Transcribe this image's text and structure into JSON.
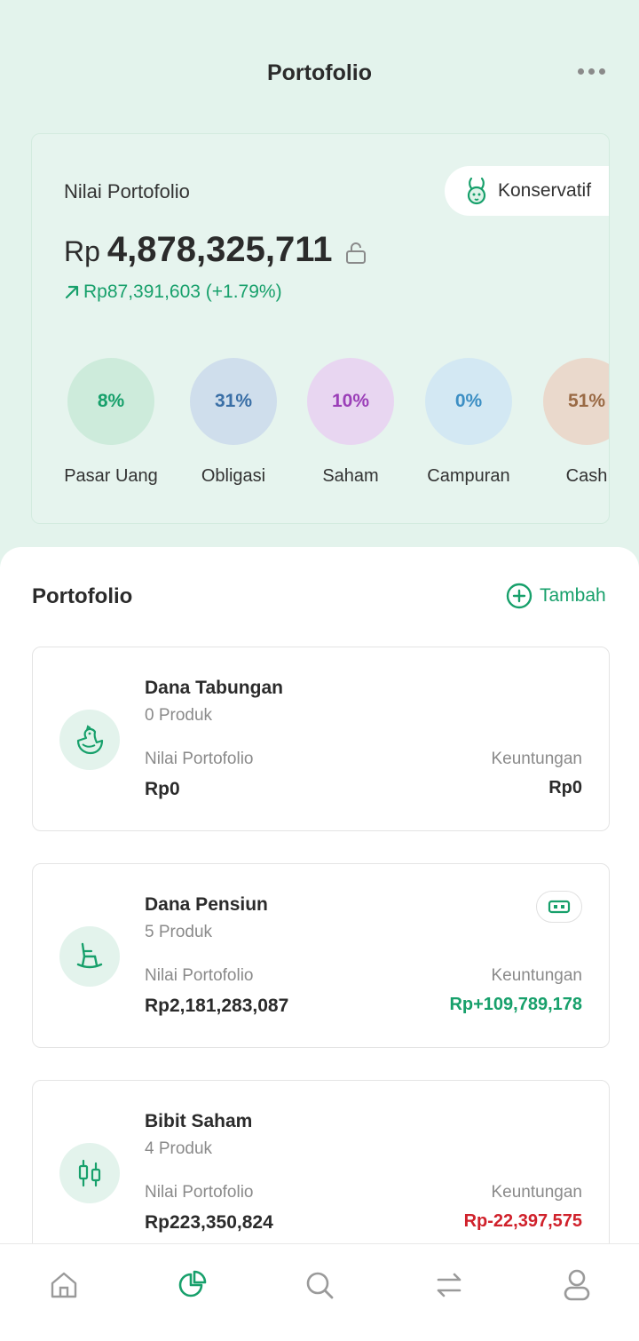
{
  "header": {
    "title": "Portofolio",
    "more_icon": "more-horizontal-icon"
  },
  "summary": {
    "label": "Nilai Portofolio",
    "risk_profile": "Konservatif",
    "risk_icon": "rabbit-icon",
    "currency": "Rp",
    "total_value": "4,878,325,711",
    "lock_icon": "unlock-icon",
    "gain": "Rp87,391,603 (+1.79%)",
    "gain_icon": "arrow-up-right-icon",
    "allocations": [
      {
        "name": "Pasar Uang",
        "percent": "8%",
        "bg": "#cdebdb",
        "fg": "#17a06b"
      },
      {
        "name": "Obligasi",
        "percent": "31%",
        "bg": "#cfdeec",
        "fg": "#3a6fa6"
      },
      {
        "name": "Saham",
        "percent": "10%",
        "bg": "#e8d6f1",
        "fg": "#9b3fb8"
      },
      {
        "name": "Campuran",
        "percent": "0%",
        "bg": "#d3e8f3",
        "fg": "#3d8fc4"
      },
      {
        "name": "Cash",
        "percent": "51%",
        "bg": "#ead9cc",
        "fg": "#9a6a45"
      }
    ]
  },
  "portfolio_list": {
    "title": "Portofolio",
    "add_label": "Tambah",
    "items": [
      {
        "name": "Dana Tabungan",
        "count": "0 Produk",
        "icon": "hen-icon",
        "value_label": "Nilai Portofolio",
        "value": "Rp0",
        "gain_label": "Keuntungan",
        "gain": "Rp0",
        "gain_color": "#2b2b2b"
      },
      {
        "name": "Dana Pensiun",
        "count": "5 Produk",
        "icon": "rocking-chair-icon",
        "value_label": "Nilai Portofolio",
        "value": "Rp2,181,283,087",
        "gain_label": "Keuntungan",
        "gain": "Rp+109,789,178",
        "gain_color": "#17a06b"
      },
      {
        "name": "Bibit Saham",
        "count": "4 Produk",
        "icon": "candlestick-icon",
        "value_label": "Nilai Portofolio",
        "value": "Rp223,350,824",
        "gain_label": "Keuntungan",
        "gain": "Rp-22,397,575",
        "gain_color": "#d0212b"
      }
    ]
  },
  "nav": {
    "items": [
      "home-icon",
      "pie-chart-icon",
      "search-icon",
      "transfer-icon",
      "profile-icon"
    ],
    "active": "pie-chart-icon",
    "active_color": "#17a06b",
    "inactive_color": "#9a9a9a"
  },
  "colors": {
    "accent": "#17a06b",
    "negative": "#d0212b",
    "background": "#e3f3ec"
  }
}
